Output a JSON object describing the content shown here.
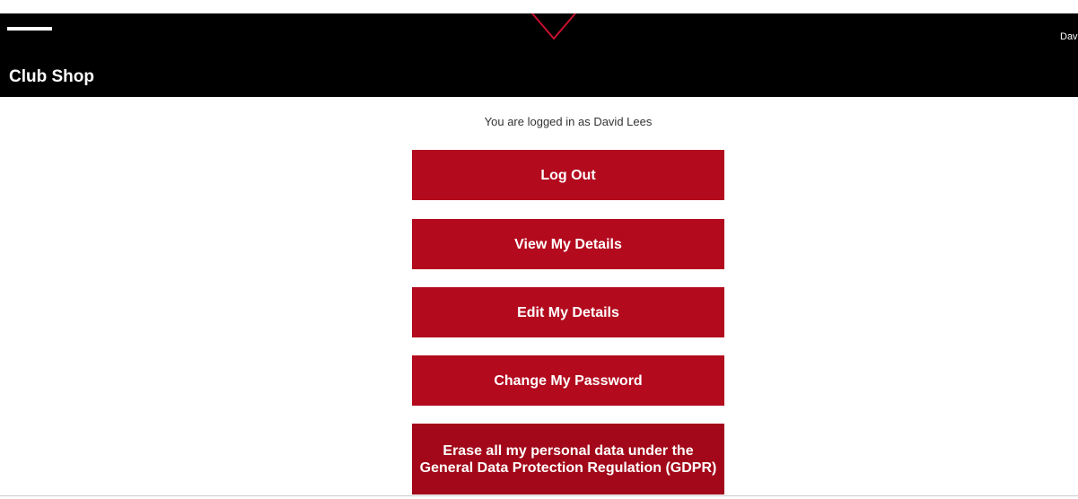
{
  "header": {
    "title": "Club Shop",
    "user_truncated": "Dav",
    "background": "#000000",
    "accent": "#c8102e"
  },
  "account": {
    "logged_in_text": "You are logged in as David Lees",
    "buttons": [
      {
        "label": "Log Out"
      },
      {
        "label": "View My Details"
      },
      {
        "label": "Edit My Details"
      },
      {
        "label": "Change My Password"
      },
      {
        "label": "Erase all my personal data under the General Data Protection Regulation (GDPR)"
      }
    ],
    "button_color": "#b30a1e"
  }
}
